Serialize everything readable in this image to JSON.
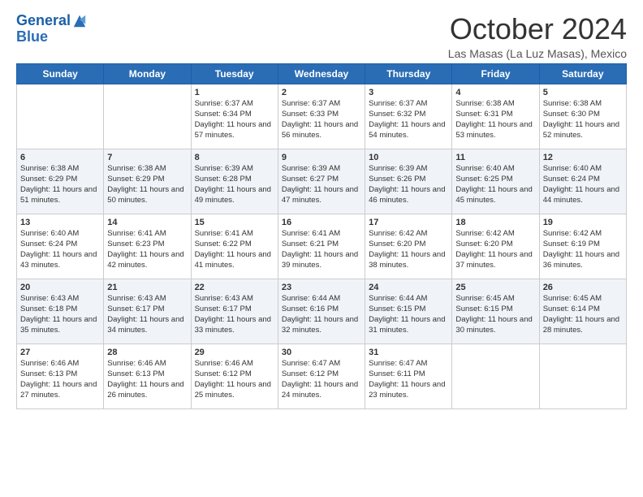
{
  "header": {
    "logo_line1": "General",
    "logo_line2": "Blue",
    "month": "October 2024",
    "location": "Las Masas (La Luz Masas), Mexico"
  },
  "days_of_week": [
    "Sunday",
    "Monday",
    "Tuesday",
    "Wednesday",
    "Thursday",
    "Friday",
    "Saturday"
  ],
  "weeks": [
    [
      {
        "day": "",
        "info": ""
      },
      {
        "day": "",
        "info": ""
      },
      {
        "day": "1",
        "info": "Sunrise: 6:37 AM\nSunset: 6:34 PM\nDaylight: 11 hours and 57 minutes."
      },
      {
        "day": "2",
        "info": "Sunrise: 6:37 AM\nSunset: 6:33 PM\nDaylight: 11 hours and 56 minutes."
      },
      {
        "day": "3",
        "info": "Sunrise: 6:37 AM\nSunset: 6:32 PM\nDaylight: 11 hours and 54 minutes."
      },
      {
        "day": "4",
        "info": "Sunrise: 6:38 AM\nSunset: 6:31 PM\nDaylight: 11 hours and 53 minutes."
      },
      {
        "day": "5",
        "info": "Sunrise: 6:38 AM\nSunset: 6:30 PM\nDaylight: 11 hours and 52 minutes."
      }
    ],
    [
      {
        "day": "6",
        "info": "Sunrise: 6:38 AM\nSunset: 6:29 PM\nDaylight: 11 hours and 51 minutes."
      },
      {
        "day": "7",
        "info": "Sunrise: 6:38 AM\nSunset: 6:29 PM\nDaylight: 11 hours and 50 minutes."
      },
      {
        "day": "8",
        "info": "Sunrise: 6:39 AM\nSunset: 6:28 PM\nDaylight: 11 hours and 49 minutes."
      },
      {
        "day": "9",
        "info": "Sunrise: 6:39 AM\nSunset: 6:27 PM\nDaylight: 11 hours and 47 minutes."
      },
      {
        "day": "10",
        "info": "Sunrise: 6:39 AM\nSunset: 6:26 PM\nDaylight: 11 hours and 46 minutes."
      },
      {
        "day": "11",
        "info": "Sunrise: 6:40 AM\nSunset: 6:25 PM\nDaylight: 11 hours and 45 minutes."
      },
      {
        "day": "12",
        "info": "Sunrise: 6:40 AM\nSunset: 6:24 PM\nDaylight: 11 hours and 44 minutes."
      }
    ],
    [
      {
        "day": "13",
        "info": "Sunrise: 6:40 AM\nSunset: 6:24 PM\nDaylight: 11 hours and 43 minutes."
      },
      {
        "day": "14",
        "info": "Sunrise: 6:41 AM\nSunset: 6:23 PM\nDaylight: 11 hours and 42 minutes."
      },
      {
        "day": "15",
        "info": "Sunrise: 6:41 AM\nSunset: 6:22 PM\nDaylight: 11 hours and 41 minutes."
      },
      {
        "day": "16",
        "info": "Sunrise: 6:41 AM\nSunset: 6:21 PM\nDaylight: 11 hours and 39 minutes."
      },
      {
        "day": "17",
        "info": "Sunrise: 6:42 AM\nSunset: 6:20 PM\nDaylight: 11 hours and 38 minutes."
      },
      {
        "day": "18",
        "info": "Sunrise: 6:42 AM\nSunset: 6:20 PM\nDaylight: 11 hours and 37 minutes."
      },
      {
        "day": "19",
        "info": "Sunrise: 6:42 AM\nSunset: 6:19 PM\nDaylight: 11 hours and 36 minutes."
      }
    ],
    [
      {
        "day": "20",
        "info": "Sunrise: 6:43 AM\nSunset: 6:18 PM\nDaylight: 11 hours and 35 minutes."
      },
      {
        "day": "21",
        "info": "Sunrise: 6:43 AM\nSunset: 6:17 PM\nDaylight: 11 hours and 34 minutes."
      },
      {
        "day": "22",
        "info": "Sunrise: 6:43 AM\nSunset: 6:17 PM\nDaylight: 11 hours and 33 minutes."
      },
      {
        "day": "23",
        "info": "Sunrise: 6:44 AM\nSunset: 6:16 PM\nDaylight: 11 hours and 32 minutes."
      },
      {
        "day": "24",
        "info": "Sunrise: 6:44 AM\nSunset: 6:15 PM\nDaylight: 11 hours and 31 minutes."
      },
      {
        "day": "25",
        "info": "Sunrise: 6:45 AM\nSunset: 6:15 PM\nDaylight: 11 hours and 30 minutes."
      },
      {
        "day": "26",
        "info": "Sunrise: 6:45 AM\nSunset: 6:14 PM\nDaylight: 11 hours and 28 minutes."
      }
    ],
    [
      {
        "day": "27",
        "info": "Sunrise: 6:46 AM\nSunset: 6:13 PM\nDaylight: 11 hours and 27 minutes."
      },
      {
        "day": "28",
        "info": "Sunrise: 6:46 AM\nSunset: 6:13 PM\nDaylight: 11 hours and 26 minutes."
      },
      {
        "day": "29",
        "info": "Sunrise: 6:46 AM\nSunset: 6:12 PM\nDaylight: 11 hours and 25 minutes."
      },
      {
        "day": "30",
        "info": "Sunrise: 6:47 AM\nSunset: 6:12 PM\nDaylight: 11 hours and 24 minutes."
      },
      {
        "day": "31",
        "info": "Sunrise: 6:47 AM\nSunset: 6:11 PM\nDaylight: 11 hours and 23 minutes."
      },
      {
        "day": "",
        "info": ""
      },
      {
        "day": "",
        "info": ""
      }
    ]
  ]
}
